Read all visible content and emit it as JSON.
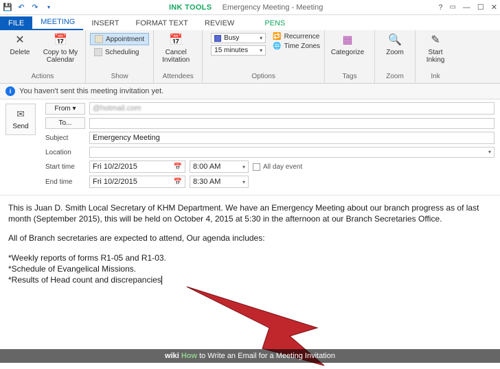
{
  "window": {
    "ink_tools": "INK TOOLS",
    "title": "Emergency Meeting - Meeting"
  },
  "tabs": {
    "file": "FILE",
    "meeting": "MEETING",
    "insert": "INSERT",
    "format_text": "FORMAT TEXT",
    "review": "REVIEW",
    "pens": "PENS"
  },
  "ribbon": {
    "actions": {
      "delete": "Delete",
      "copy": "Copy to My Calendar",
      "group": "Actions"
    },
    "show": {
      "appointment": "Appointment",
      "scheduling": "Scheduling",
      "group": "Show"
    },
    "attendees": {
      "cancel": "Cancel Invitation",
      "group": "Attendees"
    },
    "options": {
      "busy": "Busy",
      "reminder": "15 minutes",
      "recurrence": "Recurrence",
      "timezones": "Time Zones",
      "group": "Options"
    },
    "tags": {
      "categorize": "Categorize",
      "group": "Tags"
    },
    "zoom": {
      "zoom": "Zoom",
      "group": "Zoom"
    },
    "ink": {
      "start": "Start Inking",
      "group": "Ink"
    }
  },
  "infobar": "You haven't sent this meeting invitation yet.",
  "header": {
    "send": "Send",
    "from_label": "From ▾",
    "from_value": "@hotmail.com",
    "to_label": "To...",
    "subject_label": "Subject",
    "subject_value": "Emergency Meeting",
    "location_label": "Location",
    "start_label": "Start time",
    "end_label": "End time",
    "start_date": "Fri 10/2/2015",
    "end_date": "Fri 10/2/2015",
    "start_time": "8:00 AM",
    "end_time": "8:30 AM",
    "allday": "All day event"
  },
  "body": {
    "p1": "This is Juan D. Smith Local Secretary of KHM Department. We have an Emergency Meeting about our branch progress as of last month (September 2015), this will be held on October 4, 2015 at 5:30 in the afternoon at our Branch Secretaries Office.",
    "p2": "All of Branch secretaries are expected to attend, Our agenda includes:",
    "b1": "*Weekly reports of forms R1-05 and R1-03.",
    "b2": "*Schedule of Evangelical Missions.",
    "b3": "*Results of Head count and discrepancies"
  },
  "footer": {
    "wiki": "wiki",
    "how": "How",
    "caption": " to Write an Email for a Meeting Invitation"
  }
}
